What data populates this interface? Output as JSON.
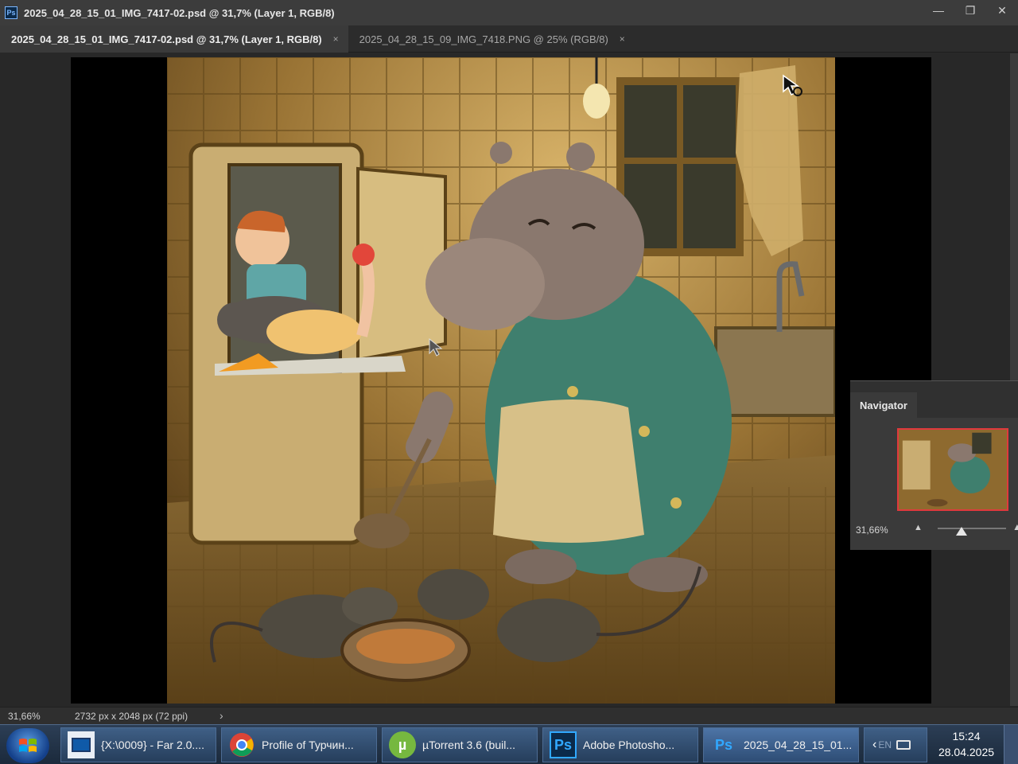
{
  "window": {
    "title": "2025_04_28_15_01_IMG_7417-02.psd @ 31,7% (Layer 1, RGB/8)",
    "app_badge": "Ps",
    "minimize": "—",
    "restore": "❐",
    "close": "✕"
  },
  "tabs": [
    {
      "label": "2025_04_28_15_01_IMG_7417-02.psd @ 31,7% (Layer 1, RGB/8)",
      "close": "×",
      "active": true
    },
    {
      "label": "2025_04_28_15_09_IMG_7418.PNG @ 25% (RGB/8)",
      "close": "×",
      "active": false
    }
  ],
  "navigator": {
    "title": "Navigator",
    "zoom": "31,66%",
    "slider_fraction": 0.35
  },
  "status": {
    "zoom": "31,66%",
    "doc_size": "2732 px x 2048 px (72 ppi)",
    "arrow": "›"
  },
  "taskbar": {
    "items": [
      {
        "label": "{X:\\0009} - Far 2.0....",
        "icon": "far-manager-icon"
      },
      {
        "label": "Profile of Турчин...",
        "icon": "chrome-icon"
      },
      {
        "label": "µTorrent 3.6  (buil...",
        "icon": "utorrent-icon"
      },
      {
        "label": "Adobe Photosho...",
        "icon": "photoshop-icon"
      },
      {
        "label": "2025_04_28_15_01...",
        "icon": "photoshop-icon"
      }
    ],
    "tray_lang": "EN",
    "clock_time": "15:24",
    "clock_date": "28.04.2025"
  },
  "colors": {
    "accent_border": "#e0393d",
    "ps_blue": "#0b2a4a",
    "taskbar": "#2c3e55"
  }
}
